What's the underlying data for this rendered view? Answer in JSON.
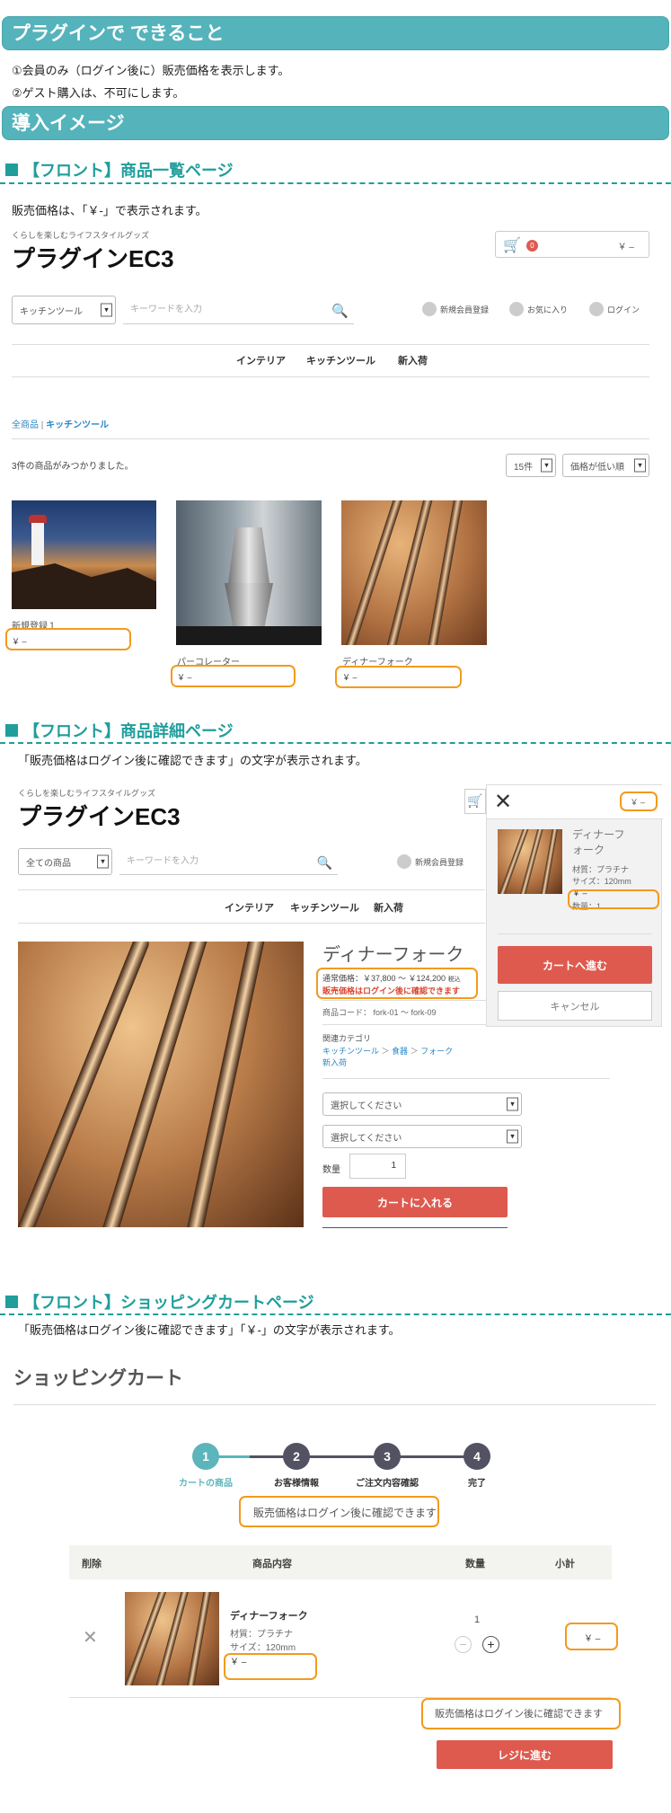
{
  "sec1": {
    "title": "プラグインで できること",
    "lines": [
      "①会員のみ（ログイン後に）販売価格を表示します。",
      "②ゲスト購入は、不可にします。"
    ]
  },
  "sec2": {
    "title": "導入イメージ"
  },
  "list": {
    "heading": "【フロント】商品一覧ページ",
    "note": "販売価格は、「￥-」で表示されます。",
    "tagline": "くらしを楽しむライフスタイルグッズ",
    "logo": "プラグインEC3",
    "cart_price": "￥ –",
    "cart_count": "0",
    "category_select": "キッチンツール",
    "search_placeholder": "キーワードを入力",
    "user_links": [
      "新規会員登録",
      "お気に入り",
      "ログイン"
    ],
    "nav": [
      "インテリア",
      "キッチンツール",
      "新入荷"
    ],
    "breadcrumb": [
      "全商品",
      "キッチンツール"
    ],
    "count_text": "3件の商品がみつかりました。",
    "per_page": "15件",
    "sort": "価格が低い順",
    "products": [
      {
        "name": "新規登録１",
        "price": "￥ –"
      },
      {
        "name": "パーコレーター",
        "price": "￥ –"
      },
      {
        "name": "ディナーフォーク",
        "price": "￥ –"
      }
    ]
  },
  "detail": {
    "heading": "【フロント】商品詳細ページ",
    "note": "「販売価格はログイン後に確認できます」の文字が表示されます。",
    "tagline": "くらしを楽しむライフスタイルグッズ",
    "logo": "プラグインEC3",
    "category_select": "全ての商品",
    "search_placeholder": "キーワードを入力",
    "user_link": "新規会員登録",
    "nav": [
      "インテリア",
      "キッチンツール",
      "新入荷"
    ],
    "product_name": "ディナーフォーク",
    "regular_price": "通常価格：￥37,800 ～ ￥124,200",
    "tax_label": "税込",
    "login_notice": "販売価格はログイン後に確認できます",
    "product_code": "商品コード： fork-01 ～ fork-09",
    "related_label": "関連カテゴリ",
    "related_path": [
      "キッチンツール",
      "食器",
      "フォーク"
    ],
    "related_new": "新入荷",
    "select1": "選択してください",
    "select2": "選択してください",
    "qty_label": "数量",
    "qty_value": "1",
    "add_cart": "カートに入れる",
    "popup": {
      "price": "￥ –",
      "item_name": "ディナーフォーク",
      "material": "材質：プラチナ",
      "size": "サイズ：120mm",
      "item_price": "￥ –",
      "qty": "数量：1",
      "checkout": "カートへ進む",
      "cancel": "キャンセル"
    }
  },
  "cart": {
    "heading": "【フロント】ショッピングカートページ",
    "note": "「販売価格はログイン後に確認できます」「￥-」の文字が表示されます。",
    "title": "ショッピングカート",
    "steps": [
      {
        "num": "1",
        "label": "カートの商品"
      },
      {
        "num": "2",
        "label": "お客様情報"
      },
      {
        "num": "3",
        "label": "ご注文内容確認"
      },
      {
        "num": "4",
        "label": "完了"
      }
    ],
    "notice_top": "販売価格はログイン後に確認できます",
    "columns": [
      "削除",
      "商品内容",
      "数量",
      "小計"
    ],
    "item": {
      "name": "ディナーフォーク",
      "material": "材質：プラチナ",
      "size": "サイズ：120mm",
      "price": "￥ –",
      "qty": "1",
      "subtotal": "￥ –"
    },
    "notice_bottom": "販売価格はログイン後に確認できます",
    "checkout": "レジに進む"
  },
  "colors": {
    "teal": "#55b3bb",
    "heading": "#1f9e9c",
    "orange": "#f39a1d",
    "red": "#de5a4f",
    "step_active": "#5bb5bb",
    "step_inactive": "#525263"
  }
}
